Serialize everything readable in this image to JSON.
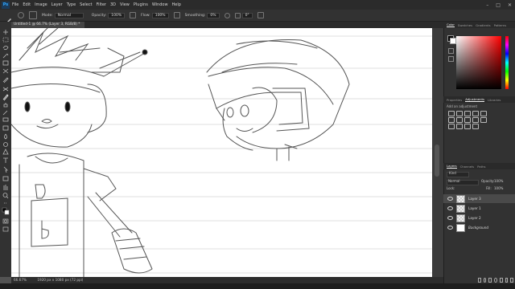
{
  "app": {
    "logo": "Ps"
  },
  "menubar": {
    "items": [
      "File",
      "Edit",
      "Image",
      "Layer",
      "Type",
      "Select",
      "Filter",
      "3D",
      "View",
      "Plugins",
      "Window",
      "Help"
    ]
  },
  "window_controls": {
    "minimize": "–",
    "maximize": "□",
    "close": "✕"
  },
  "options_bar": {
    "mode_label": "Mode:",
    "mode_value": "Normal",
    "opacity_label": "Opacity:",
    "opacity_value": "100%",
    "flow_label": "Flow:",
    "flow_value": "100%",
    "smoothing_label": "Smoothing:",
    "smoothing_value": "0%",
    "angle_value": "0°"
  },
  "document": {
    "tab_title": "Untitled-1 @ 66.7% (Layer 3, RGB/8) *"
  },
  "status_bar": {
    "zoom": "66.67%",
    "doc_info": "1920 px x 1080 px (72 ppi)"
  },
  "colors": {
    "foreground": "#000000",
    "background": "#ffffff",
    "accent": "#31a8ff"
  },
  "panels": {
    "color_tabs": [
      "Color",
      "Swatches",
      "Gradients",
      "Patterns"
    ],
    "properties_tabs": [
      "Properties",
      "Adjustments",
      "Libraries"
    ],
    "adjustments_label": "Add an adjustment",
    "layers_tabs": [
      "Layers",
      "Channels",
      "Paths"
    ],
    "layers_kind": "Kind",
    "blend_mode": "Normal",
    "opacity_label": "Opacity:",
    "opacity_value": "100%",
    "lock_label": "Lock:",
    "fill_label": "Fill:",
    "fill_value": "100%"
  },
  "layers": [
    {
      "name": "Layer 3",
      "selected": true,
      "thumb": "transparent"
    },
    {
      "name": "Layer 1",
      "selected": false,
      "thumb": "transparent"
    },
    {
      "name": "Layer 2",
      "selected": false,
      "thumb": "transparent"
    },
    {
      "name": "Background",
      "selected": false,
      "thumb": "white"
    }
  ]
}
